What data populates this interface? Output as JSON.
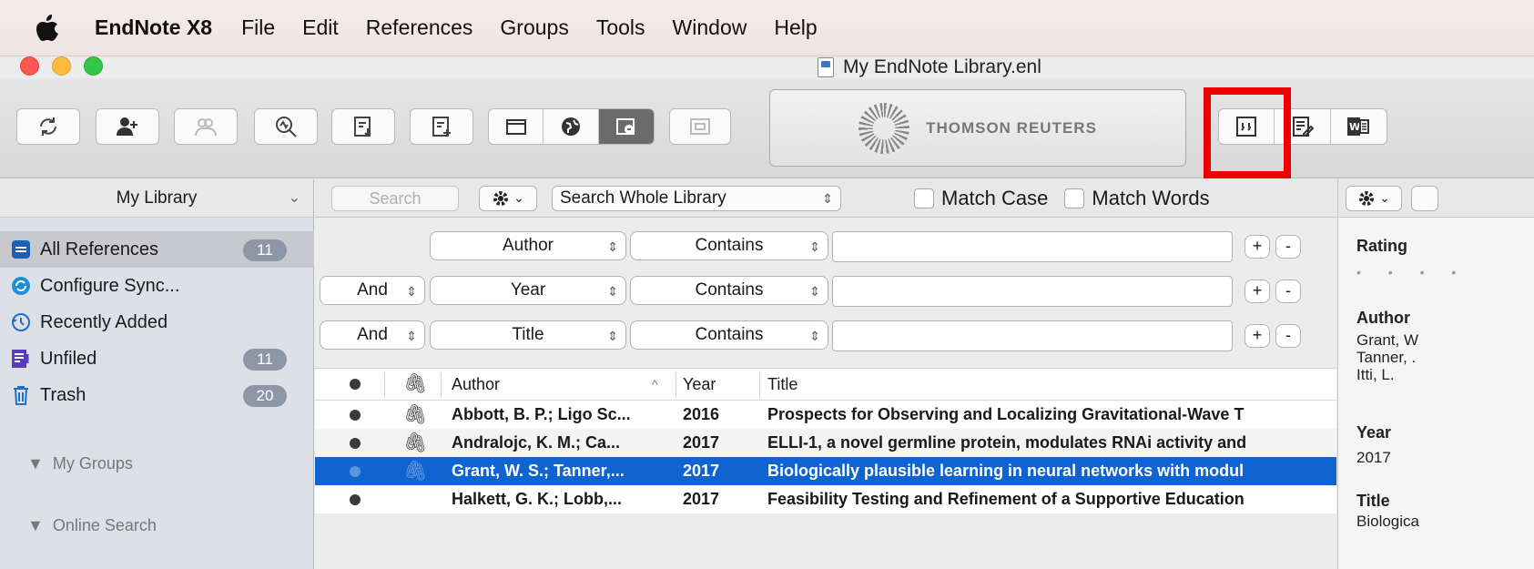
{
  "menubar": {
    "app_name": "EndNote X8",
    "items": [
      "File",
      "Edit",
      "References",
      "Groups",
      "Tools",
      "Window",
      "Help"
    ]
  },
  "window": {
    "title": "My EndNote Library.enl"
  },
  "toolbar": {
    "logo_text": "THOMSON REUTERS"
  },
  "sidebar": {
    "header": "My Library",
    "items": [
      {
        "label": "All References",
        "count": "11"
      },
      {
        "label": "Configure Sync...",
        "count": ""
      },
      {
        "label": "Recently Added",
        "count": ""
      },
      {
        "label": "Unfiled",
        "count": "11"
      },
      {
        "label": "Trash",
        "count": "20"
      }
    ],
    "groups": [
      "My Groups",
      "Online Search"
    ]
  },
  "search": {
    "placeholder": "Search",
    "scope": "Search Whole Library",
    "match_case": "Match Case",
    "match_words": "Match Words",
    "rows": [
      {
        "bool": "",
        "field": "Author",
        "op": "Contains",
        "value": ""
      },
      {
        "bool": "And",
        "field": "Year",
        "op": "Contains",
        "value": ""
      },
      {
        "bool": "And",
        "field": "Title",
        "op": "Contains",
        "value": ""
      }
    ],
    "plus": "+",
    "minus": "-"
  },
  "table": {
    "headers": {
      "author": "Author",
      "year": "Year",
      "title": "Title"
    },
    "rows": [
      {
        "author": "Abbott, B. P.; Ligo Sc...",
        "year": "2016",
        "title": "Prospects for Observing and Localizing Gravitational-Wave T",
        "selected": false
      },
      {
        "author": "Andralojc, K. M.; Ca...",
        "year": "2017",
        "title": "ELLI-1, a novel germline protein, modulates RNAi activity and",
        "selected": false
      },
      {
        "author": "Grant, W. S.; Tanner,...",
        "year": "2017",
        "title": "Biologically plausible learning in neural networks with modul",
        "selected": true
      },
      {
        "author": "Halkett, G. K.; Lobb,...",
        "year": "2017",
        "title": "Feasibility Testing and Refinement of a Supportive Education",
        "selected": false
      }
    ]
  },
  "preview": {
    "rating_label": "Rating",
    "author_label": "Author",
    "authors": [
      "Grant, W",
      "Tanner, .",
      "Itti, L."
    ],
    "year_label": "Year",
    "year": "2017",
    "title_label": "Title",
    "title_value": "Biologica"
  },
  "colors": {
    "selection": "#0f64d2",
    "highlight_box": "#ee0000",
    "badge": "#8e97a7"
  }
}
